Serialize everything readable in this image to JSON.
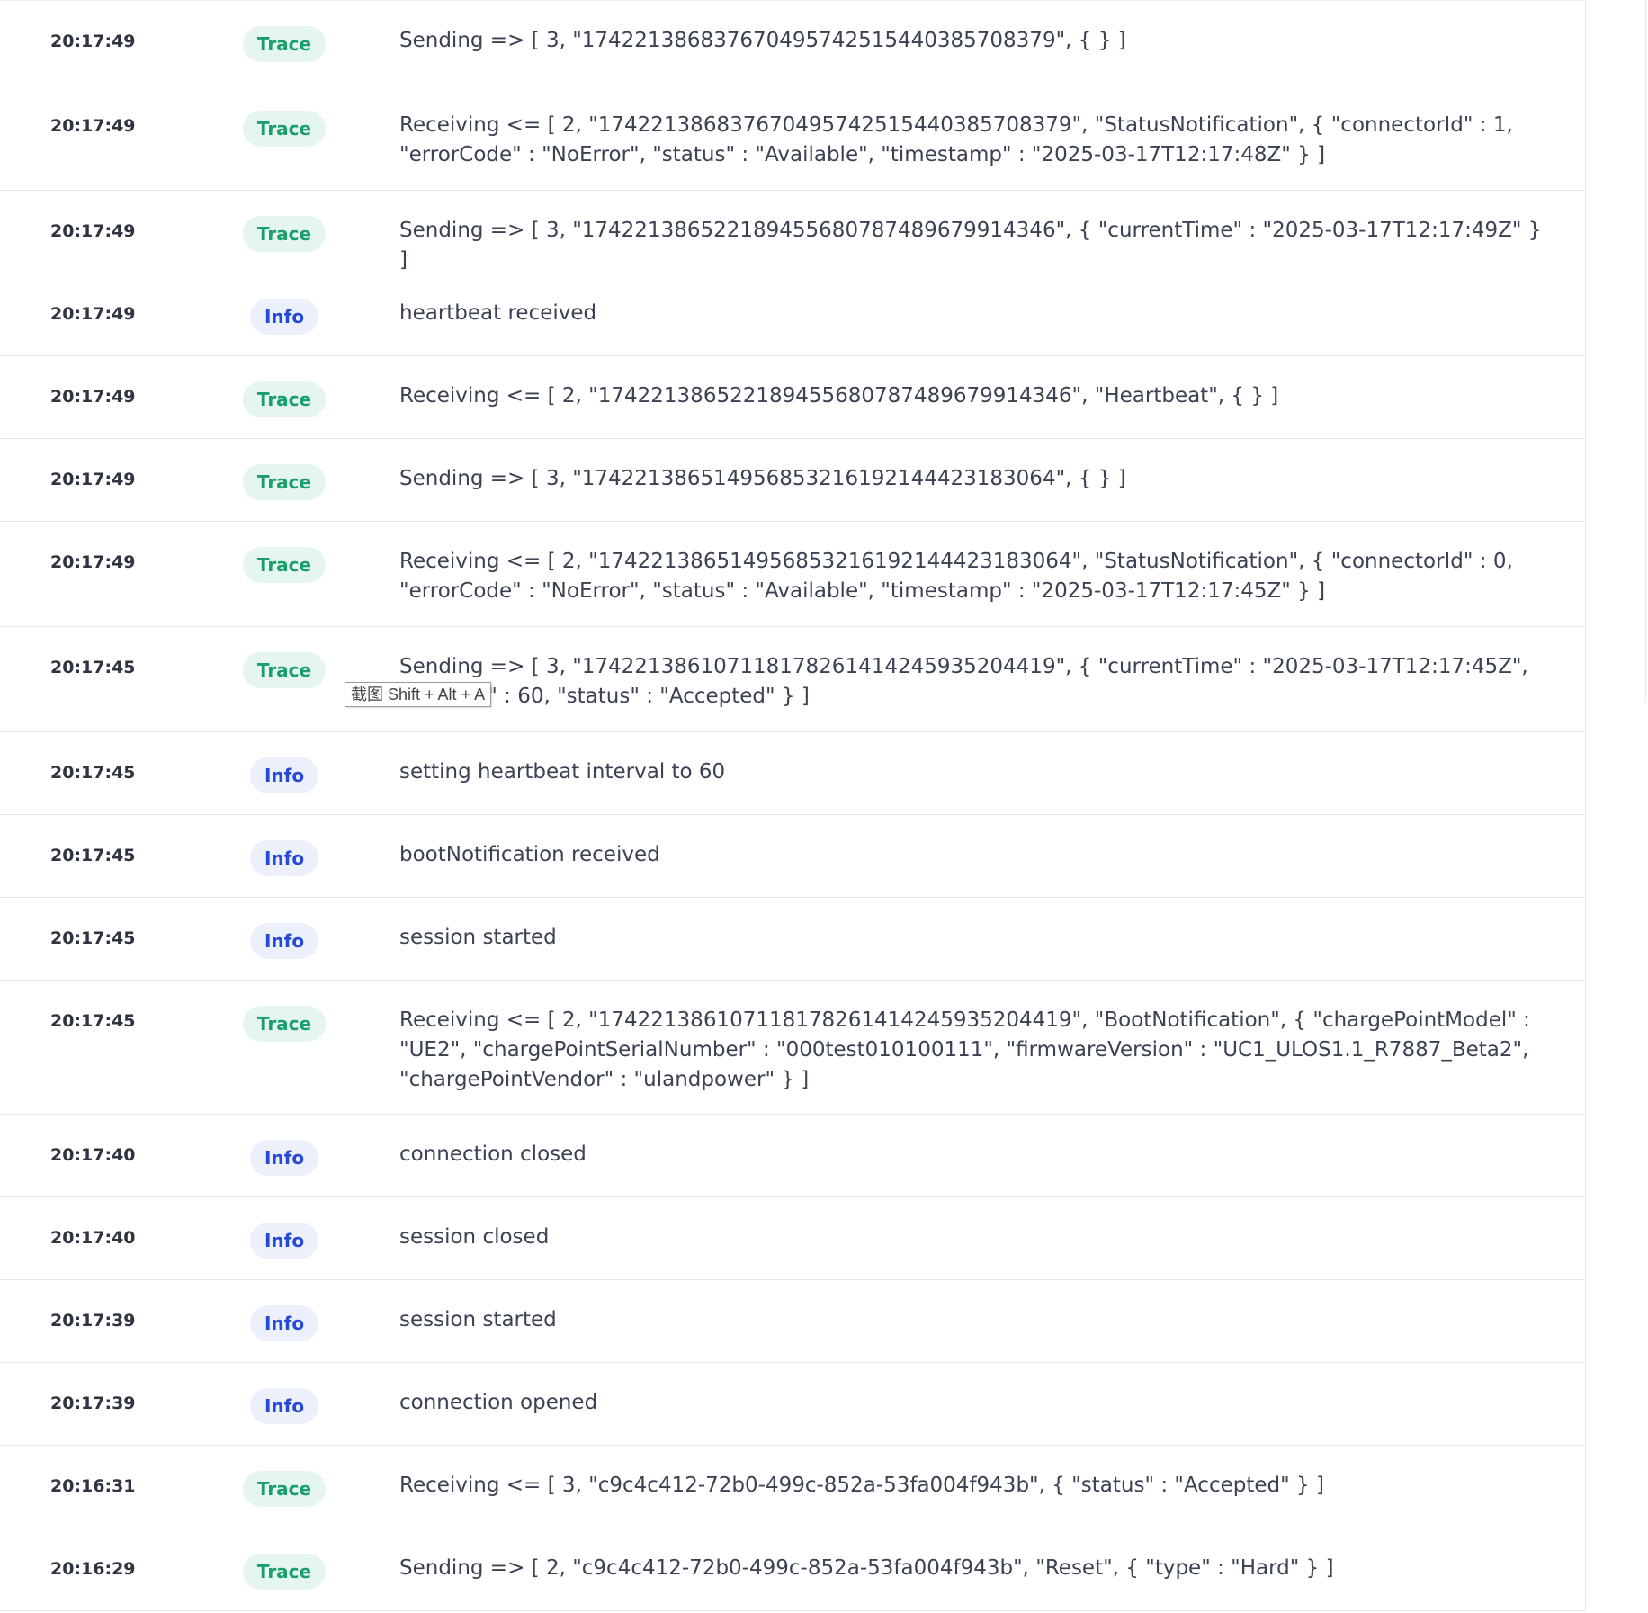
{
  "logs": [
    {
      "time": "20:17:49",
      "level": "Trace",
      "message": "Sending => [ 3, \"174221386837670495742515440385708379\", { } ]"
    },
    {
      "time": "20:17:49",
      "level": "Trace",
      "message": "Receiving <= [ 2, \"174221386837670495742515440385708379\", \"StatusNotification\", { \"connectorId\" : 1, \"errorCode\" : \"NoError\", \"status\" : \"Available\", \"timestamp\" : \"2025-03-17T12:17:48Z\" } ]"
    },
    {
      "time": "20:17:49",
      "level": "Trace",
      "message": "Sending => [ 3, \"174221386522189455680787489679914346\", { \"currentTime\" : \"2025-03-17T12:17:49Z\" } ]"
    },
    {
      "time": "20:17:49",
      "level": "Info",
      "message": "heartbeat received"
    },
    {
      "time": "20:17:49",
      "level": "Trace",
      "message": "Receiving <= [ 2, \"174221386522189455680787489679914346\", \"Heartbeat\", { } ]"
    },
    {
      "time": "20:17:49",
      "level": "Trace",
      "message": "Sending => [ 3, \"174221386514956853216192144423183064\", { } ]"
    },
    {
      "time": "20:17:49",
      "level": "Trace",
      "message": "Receiving <= [ 2, \"174221386514956853216192144423183064\", \"StatusNotification\", { \"connectorId\" : 0, \"errorCode\" : \"NoError\", \"status\" : \"Available\", \"timestamp\" : \"2025-03-17T12:17:45Z\" } ]"
    },
    {
      "time": "20:17:45",
      "level": "Trace",
      "message": "Sending => [ 3, \"174221386107118178261414245935204419\", { \"currentTime\" : \"2025-03-17T12:17:45Z\", \"interval\" : 60, \"status\" : \"Accepted\" } ]"
    },
    {
      "time": "20:17:45",
      "level": "Info",
      "message": "setting heartbeat interval to 60"
    },
    {
      "time": "20:17:45",
      "level": "Info",
      "message": "bootNotification received"
    },
    {
      "time": "20:17:45",
      "level": "Info",
      "message": "session started"
    },
    {
      "time": "20:17:45",
      "level": "Trace",
      "message": "Receiving <= [ 2, \"174221386107118178261414245935204419\", \"BootNotification\", { \"chargePointModel\" : \"UE2\", \"chargePointSerialNumber\" : \"000test010100111\", \"firmwareVersion\" : \"UC1_ULOS1.1_R7887_Beta2\", \"chargePointVendor\" : \"ulandpower\" } ]"
    },
    {
      "time": "20:17:40",
      "level": "Info",
      "message": "connection closed"
    },
    {
      "time": "20:17:40",
      "level": "Info",
      "message": "session closed"
    },
    {
      "time": "20:17:39",
      "level": "Info",
      "message": "session started"
    },
    {
      "time": "20:17:39",
      "level": "Info",
      "message": "connection opened"
    },
    {
      "time": "20:16:31",
      "level": "Trace",
      "message": "Receiving <= [ 3, \"c9c4c412-72b0-499c-852a-53fa004f943b\", { \"status\" : \"Accepted\" } ]"
    },
    {
      "time": "20:16:29",
      "level": "Trace",
      "message": "Sending => [ 2, \"c9c4c412-72b0-499c-852a-53fa004f943b\", \"Reset\", { \"type\" : \"Hard\" } ]"
    }
  ],
  "tooltip": {
    "text": "截图 Shift + Alt + A"
  },
  "colors": {
    "trace_bg": "#e5f5ef",
    "trace_fg": "#1a9e6c",
    "info_bg": "#ecf0fb",
    "info_fg": "#2649d6"
  }
}
